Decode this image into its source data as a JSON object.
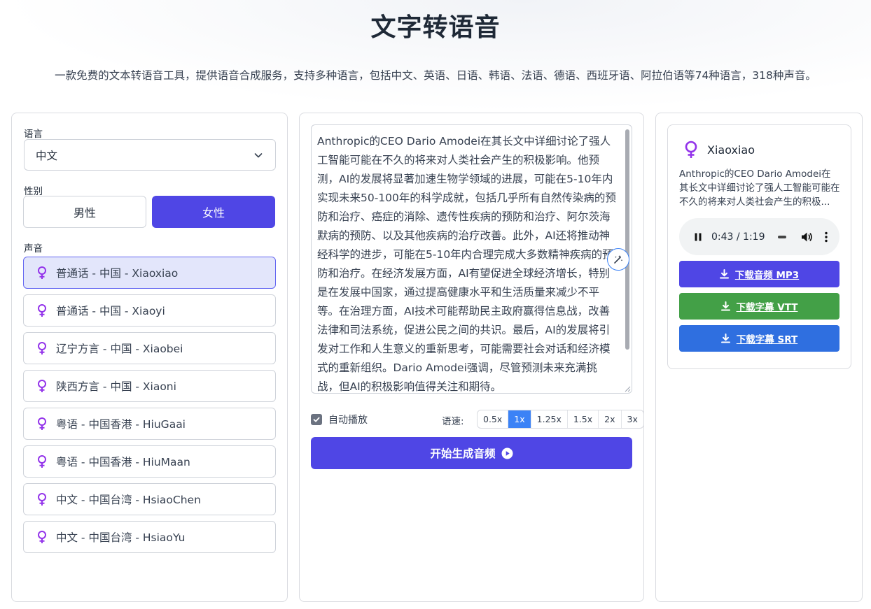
{
  "header": {
    "title": "文字转语音",
    "subtitle": "一款免费的文本转语音工具，提供语音合成服务，支持多种语言，包括中文、英语、日语、韩语、法语、德语、西班牙语、阿拉伯语等74种语言，318种声音。"
  },
  "left": {
    "language_label": "语言",
    "language_value": "中文",
    "gender_label": "性别",
    "gender_male": "男性",
    "gender_female": "女性",
    "gender_selected": "女性",
    "voice_label": "声音",
    "voices": [
      {
        "label": "普通话 - 中国 - Xiaoxiao",
        "icon": "female-icon",
        "selected": true
      },
      {
        "label": "普通话 - 中国 - Xiaoyi",
        "icon": "female-icon",
        "selected": false
      },
      {
        "label": "辽宁方言 - 中国 - Xiaobei",
        "icon": "female-icon",
        "selected": false
      },
      {
        "label": "陕西方言 - 中国 - Xiaoni",
        "icon": "female-icon",
        "selected": false
      },
      {
        "label": "粤语 - 中国香港 - HiuGaai",
        "icon": "female-icon",
        "selected": false
      },
      {
        "label": "粤语 - 中国香港 - HiuMaan",
        "icon": "female-icon",
        "selected": false
      },
      {
        "label": "中文 - 中国台湾 - HsiaoChen",
        "icon": "female-icon",
        "selected": false
      },
      {
        "label": "中文 - 中国台湾 - HsiaoYu",
        "icon": "female-icon",
        "selected": false
      }
    ]
  },
  "middle": {
    "text": "Anthropic的CEO Dario Amodei在其长文中详细讨论了强人工智能可能在不久的将来对人类社会产生的积极影响。他预测，AI的发展将显著加速生物学领域的进展，可能在5-10年内实现未来50-100年的科学成就，包括几乎所有自然传染病的预防和治疗、癌症的消除、遗传性疾病的预防和治疗、阿尔茨海默病的预防、以及其他疾病的治疗改善。此外，AI还将推动神经科学的进步，可能在5-10年内合理完成大多数精神疾病的预防和治疗。在经济发展方面，AI有望促进全球经济增长，特别是在发展中国家，通过提高健康水平和生活质量来减少不平等。在治理方面，AI技术可能帮助民主政府赢得信息战，改善法律和司法系统，促进公民之间的共识。最后，AI的发展将引发对工作和人生意义的重新思考，可能需要社会对话和经济模式的重新组织。Dario Amodei强调，尽管预测未来充满挑战，但AI的积极影响值得关注和期待。",
    "autoplay_label": "自动播放",
    "autoplay_checked": true,
    "speed_label": "语速:",
    "speeds": [
      "0.5x",
      "1x",
      "1.25x",
      "1.5x",
      "2x",
      "3x"
    ],
    "speed_selected": "1x",
    "generate_label": "开始生成音频"
  },
  "right": {
    "voice_name": "Xiaoxiao",
    "preview_text": "Anthropic的CEO Dario Amodei在其长文中详细讨论了强人工智能可能在不久的将来对人类社会产生的积极...",
    "player_time": "0:43 / 1:19",
    "download_mp3": "下载音频 MP3",
    "download_vtt": "下载字幕 VTT",
    "download_srt": "下载字幕 SRT"
  },
  "colors": {
    "primary": "#4f46e5",
    "female_icon": "#9333ea",
    "vtt_green": "#43a047",
    "srt_blue": "#2f6fe0",
    "speed_active": "#3b82f6"
  }
}
